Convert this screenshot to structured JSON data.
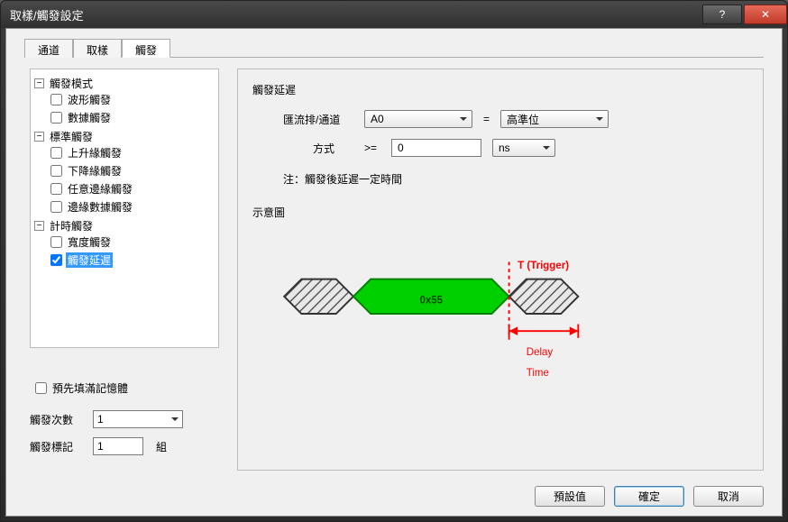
{
  "window": {
    "title": "取樣/觸發設定"
  },
  "tabs": [
    {
      "id": "channel",
      "label": "通道",
      "active": false
    },
    {
      "id": "sample",
      "label": "取樣",
      "active": false
    },
    {
      "id": "trigger",
      "label": "觸發",
      "active": true
    }
  ],
  "tree": {
    "modeGroup": {
      "label": "觸發模式",
      "expanded": true
    },
    "mode_wave": {
      "label": "波形觸發",
      "checked": false
    },
    "mode_data": {
      "label": "數據觸發",
      "checked": false
    },
    "stdGroup": {
      "label": "標準觸發",
      "expanded": true
    },
    "std_rise": {
      "label": "上升緣觸發",
      "checked": false
    },
    "std_fall": {
      "label": "下降緣觸發",
      "checked": false
    },
    "std_any": {
      "label": "任意邊緣觸發",
      "checked": false
    },
    "std_edge_data": {
      "label": "邊緣數據觸發",
      "checked": false
    },
    "timeGroup": {
      "label": "計時觸發",
      "expanded": true
    },
    "time_width": {
      "label": "寬度觸發",
      "checked": false
    },
    "time_delay": {
      "label": "觸發延遲",
      "checked": true,
      "selected": true
    }
  },
  "leftBottom": {
    "prefill": {
      "label": "預先填滿記憶體",
      "checked": false
    },
    "count": {
      "label": "觸發次數",
      "value": "1"
    },
    "mark": {
      "label": "觸發標記",
      "value": "1",
      "unit": "組"
    }
  },
  "delay": {
    "header": "觸發延遲",
    "busLabel": "匯流排/通道",
    "busValue": "A0",
    "eq": "=",
    "levelValue": "高準位",
    "modeLabel": "方式",
    "op": ">=",
    "numValue": "0",
    "unitValue": "ns",
    "note": "注：觸發後延遲一定時間"
  },
  "diagram": {
    "header": "示意圖",
    "hexLabel": "0x55",
    "triggerLabel": "T (Trigger)",
    "delayLabel1": "Delay",
    "delayLabel2": "Time"
  },
  "footer": {
    "defaultBtn": "預設值",
    "okBtn": "確定",
    "cancelBtn": "取消"
  }
}
